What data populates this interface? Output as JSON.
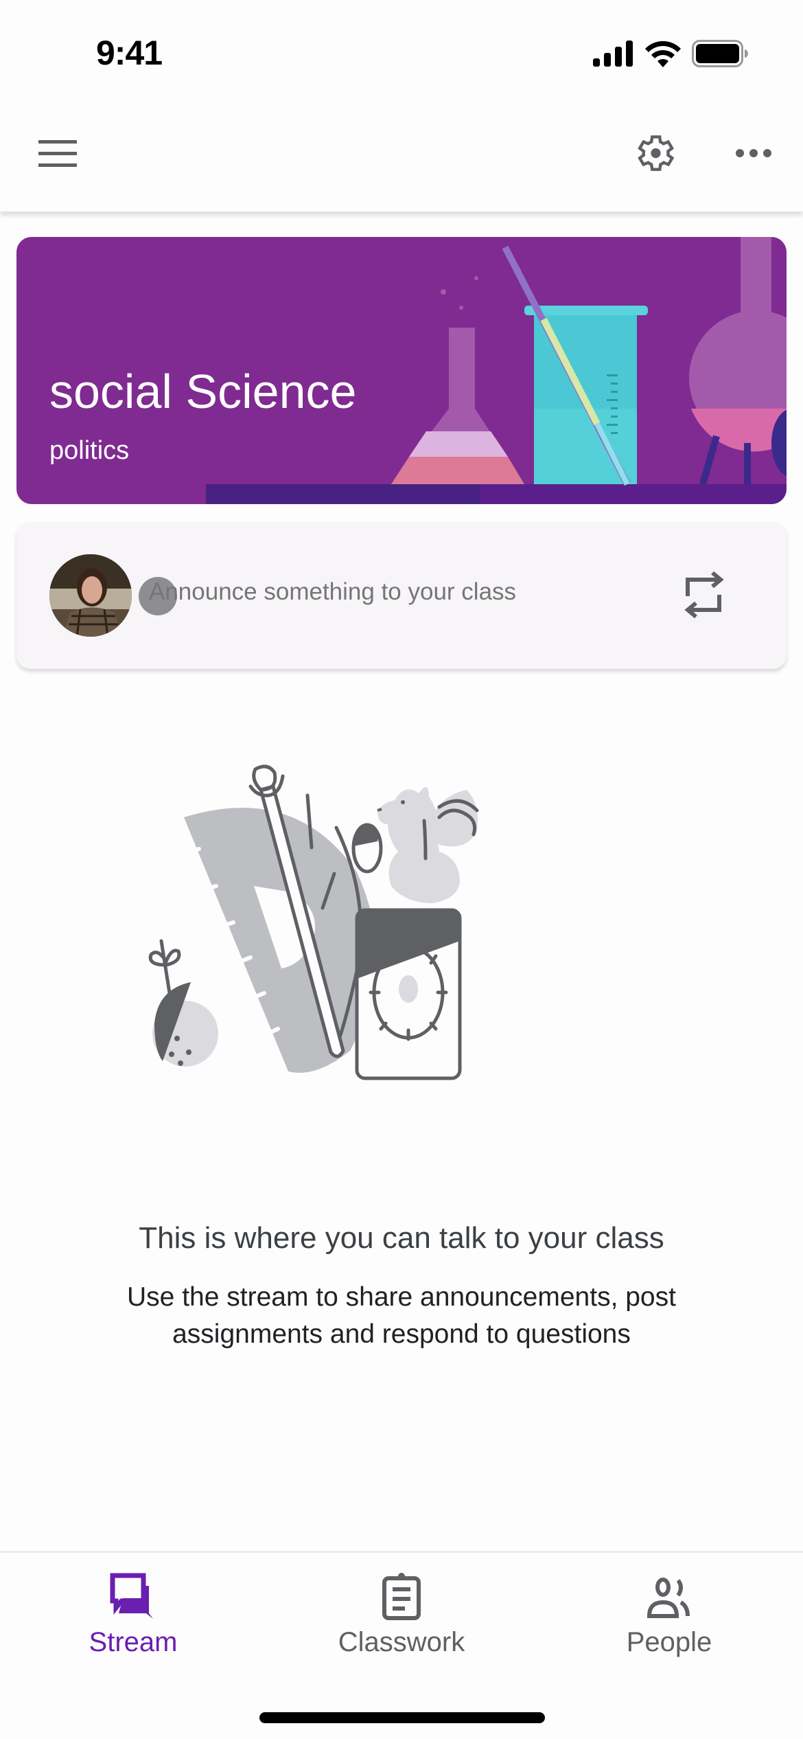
{
  "status_bar": {
    "time": "9:41",
    "icons": [
      "cellular-signal-icon",
      "wifi-icon",
      "battery-icon"
    ]
  },
  "app_bar": {
    "icons": [
      "menu-icon",
      "settings-gear-icon",
      "more-horizontal-icon"
    ]
  },
  "class_banner": {
    "title": "social Science",
    "subtitle": "politics",
    "background_color": "#7f2b91",
    "theme": "science-lab-illustration"
  },
  "announce": {
    "placeholder": "Announce something to your class",
    "avatar_alt": "User avatar",
    "repost_icon": "repost-icon"
  },
  "empty_state": {
    "illustration": "classroom-supplies-illustration",
    "title": "This is where you can talk to your class",
    "description": "Use the stream to share announcements, post assignments and respond to questions"
  },
  "bottom_nav": {
    "accent_color": "#6a1fb0",
    "items": [
      {
        "label": "Stream",
        "icon": "stream-chat-icon",
        "active": true
      },
      {
        "label": "Classwork",
        "icon": "clipboard-icon",
        "active": false
      },
      {
        "label": "People",
        "icon": "people-icon",
        "active": false
      }
    ]
  }
}
